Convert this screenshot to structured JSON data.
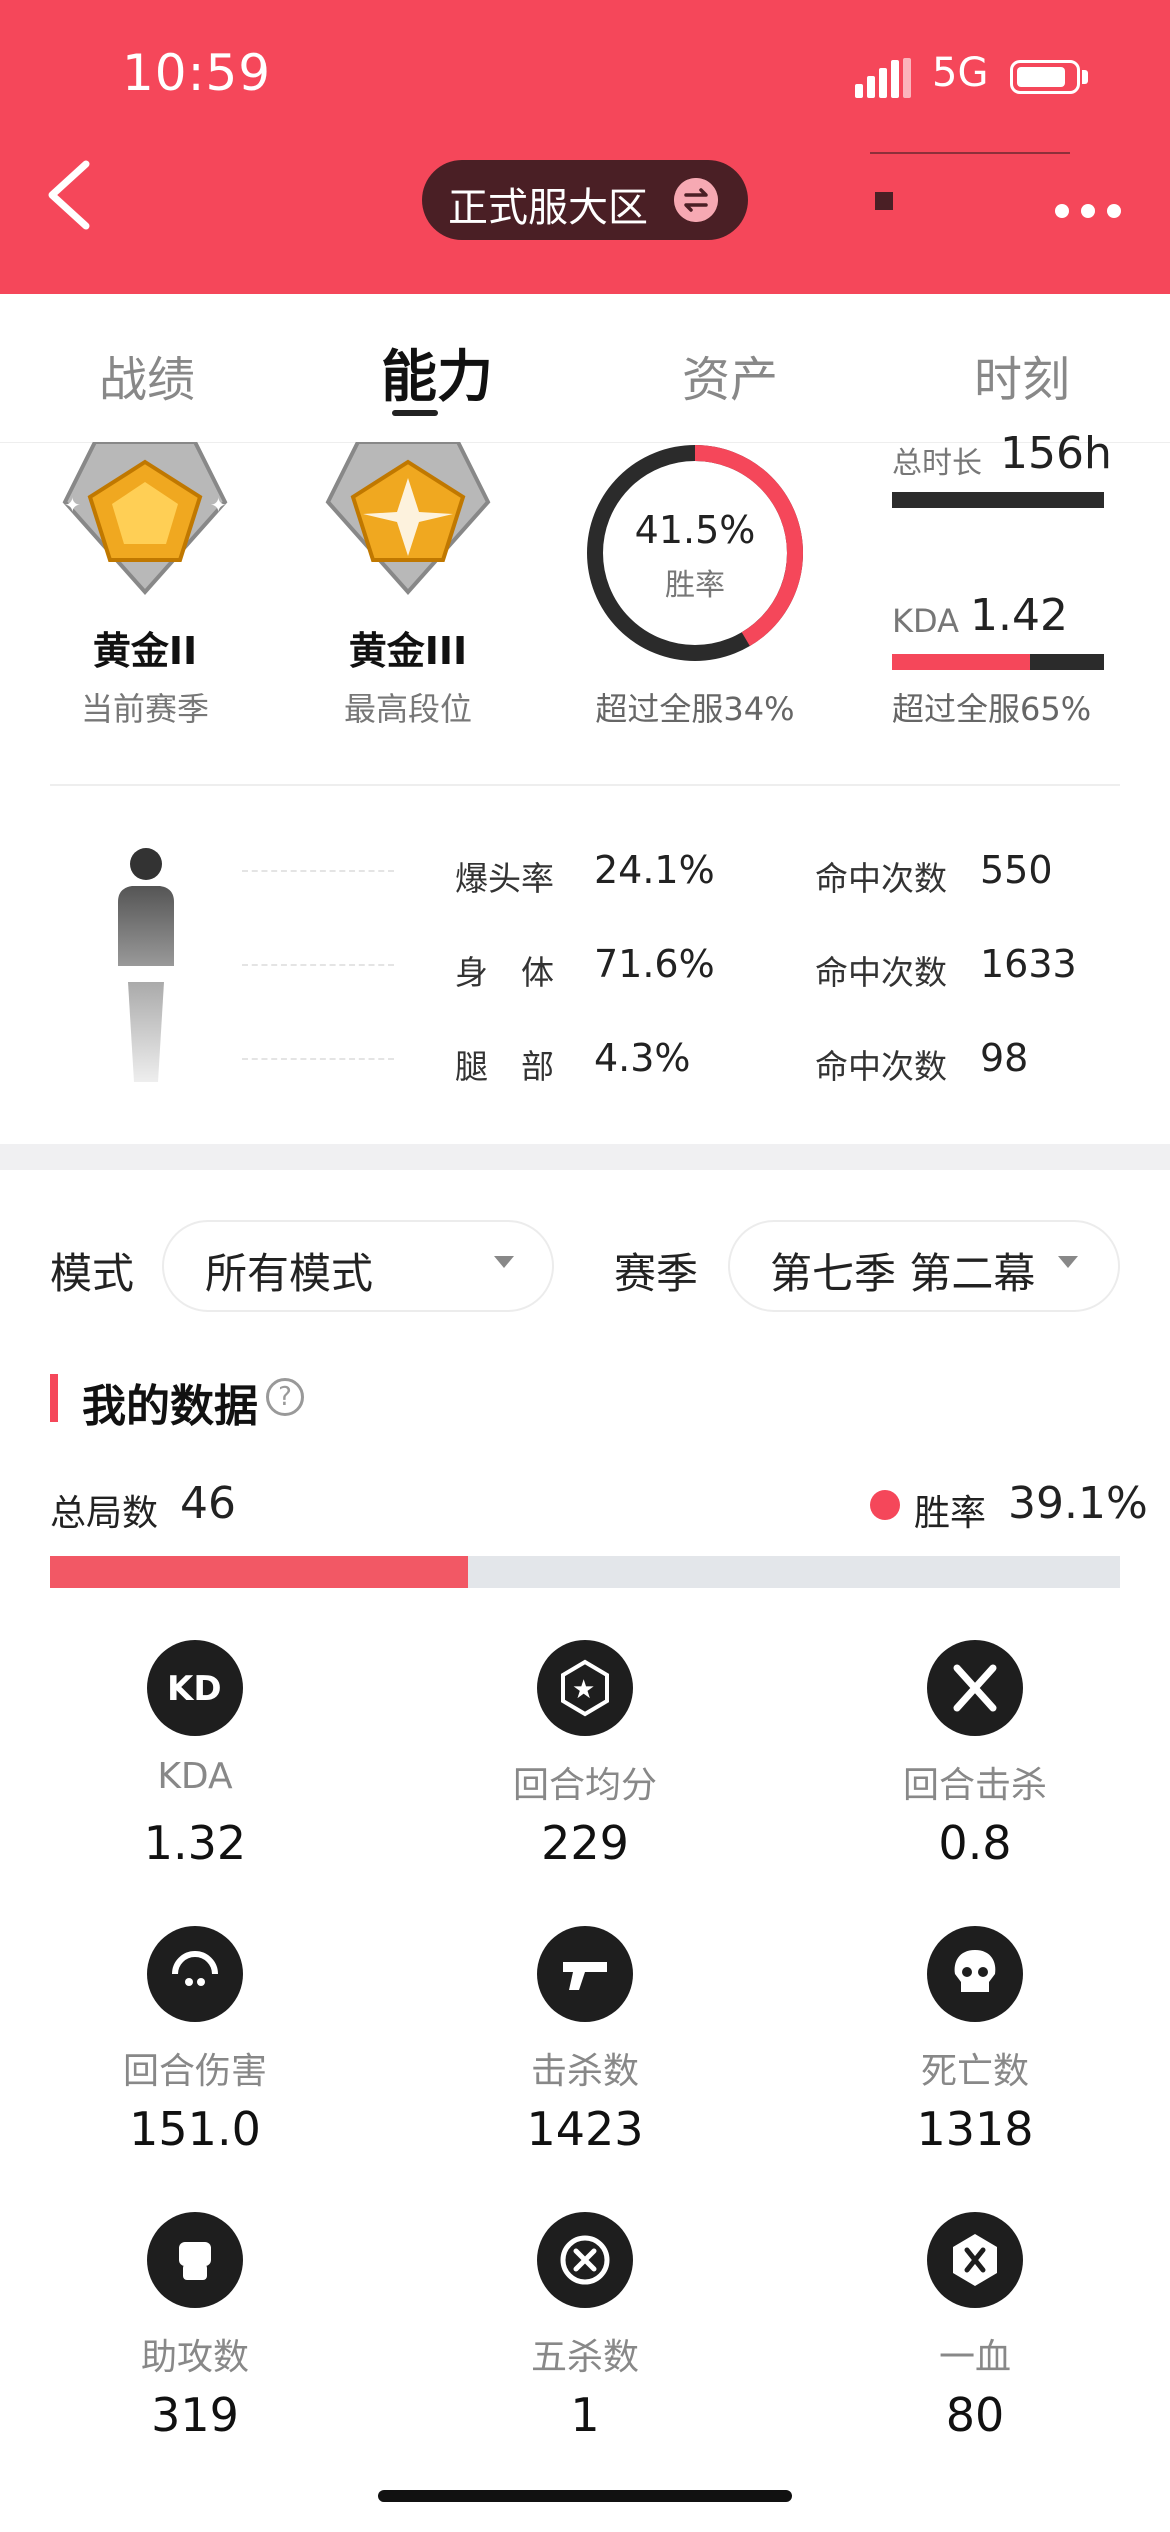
{
  "status_bar": {
    "time": "10:59",
    "network": "5G"
  },
  "header": {
    "server_label": "正式服大区"
  },
  "tabs": [
    {
      "label": "战绩"
    },
    {
      "label": "能力"
    },
    {
      "label": "资产"
    },
    {
      "label": "时刻"
    }
  ],
  "active_tab": "能力",
  "ranks": [
    {
      "name": "黄金II",
      "sub": "当前赛季"
    },
    {
      "name": "黄金III",
      "sub": "最高段位"
    }
  ],
  "winrate": {
    "value": "41.5%",
    "label": "胜率",
    "sub": "超过全服34%",
    "fraction": 0.415
  },
  "duration": {
    "label": "总时长",
    "value": "156h"
  },
  "kda": {
    "label": "KDA",
    "value": "1.42",
    "sub": "超过全服65%",
    "fraction": 0.65
  },
  "hits": [
    {
      "label": "爆头率",
      "value": "24.1%",
      "count_label": "命中次数",
      "count": "550"
    },
    {
      "label": "身　体",
      "value": "71.6%",
      "count_label": "命中次数",
      "count": "1633"
    },
    {
      "label": "腿　部",
      "value": "4.3%",
      "count_label": "命中次数",
      "count": "98"
    }
  ],
  "filters": {
    "mode_label": "模式",
    "mode_value": "所有模式",
    "season_label": "赛季",
    "season_value": "第七季 第二幕"
  },
  "my_data": {
    "title": "我的数据",
    "total_label": "总局数",
    "total_value": "46",
    "win_label": "胜率",
    "win_value": "39.1%",
    "win_fraction": 0.391
  },
  "stats": [
    {
      "label": "KDA",
      "value": "1.32",
      "icon": "kd-icon"
    },
    {
      "label": "回合均分",
      "value": "229",
      "icon": "star-badge-icon"
    },
    {
      "label": "回合击杀",
      "value": "0.8",
      "icon": "crossed-blades-icon"
    },
    {
      "label": "回合伤害",
      "value": "151.0",
      "icon": "claw-icon"
    },
    {
      "label": "击杀数",
      "value": "1423",
      "icon": "pistol-icon"
    },
    {
      "label": "死亡数",
      "value": "1318",
      "icon": "skull-icon"
    },
    {
      "label": "助攻数",
      "value": "319",
      "icon": "fist-icon"
    },
    {
      "label": "五杀数",
      "value": "1",
      "icon": "target-icon"
    },
    {
      "label": "一血",
      "value": "80",
      "icon": "blood-icon"
    }
  ],
  "colors": {
    "accent": "#f5475a",
    "dark": "#2b2b2b",
    "bar_bg": "#e3e6ea"
  }
}
